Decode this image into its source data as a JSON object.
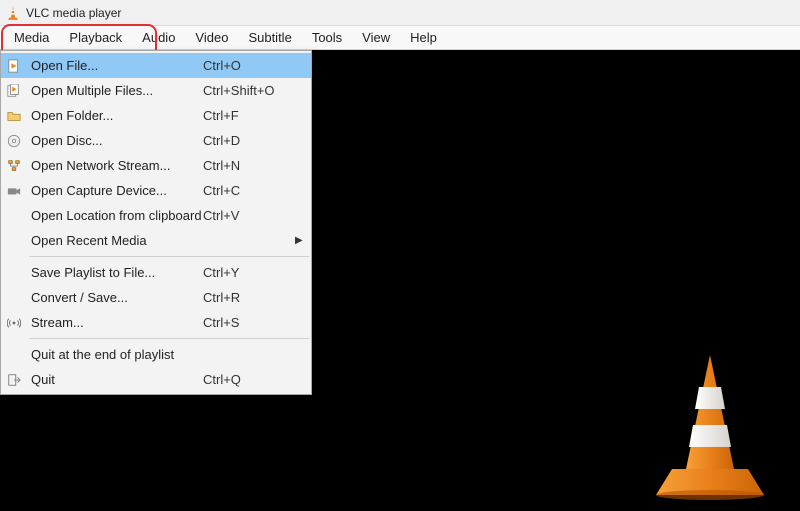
{
  "window": {
    "title": "VLC media player"
  },
  "menubar": {
    "items": [
      {
        "label": "Media"
      },
      {
        "label": "Playback"
      },
      {
        "label": "Audio"
      },
      {
        "label": "Video"
      },
      {
        "label": "Subtitle"
      },
      {
        "label": "Tools"
      },
      {
        "label": "View"
      },
      {
        "label": "Help"
      }
    ]
  },
  "media_menu": {
    "open_file": {
      "label": "Open File...",
      "shortcut": "Ctrl+O"
    },
    "open_multiple": {
      "label": "Open Multiple Files...",
      "shortcut": "Ctrl+Shift+O"
    },
    "open_folder": {
      "label": "Open Folder...",
      "shortcut": "Ctrl+F"
    },
    "open_disc": {
      "label": "Open Disc...",
      "shortcut": "Ctrl+D"
    },
    "open_network": {
      "label": "Open Network Stream...",
      "shortcut": "Ctrl+N"
    },
    "open_capture": {
      "label": "Open Capture Device...",
      "shortcut": "Ctrl+C"
    },
    "open_clipboard": {
      "label": "Open Location from clipboard",
      "shortcut": "Ctrl+V"
    },
    "open_recent": {
      "label": "Open Recent Media",
      "shortcut": ""
    },
    "save_playlist": {
      "label": "Save Playlist to File...",
      "shortcut": "Ctrl+Y"
    },
    "convert_save": {
      "label": "Convert / Save...",
      "shortcut": "Ctrl+R"
    },
    "stream": {
      "label": "Stream...",
      "shortcut": "Ctrl+S"
    },
    "quit_end": {
      "label": "Quit at the end of playlist",
      "shortcut": ""
    },
    "quit": {
      "label": "Quit",
      "shortcut": "Ctrl+Q"
    }
  }
}
